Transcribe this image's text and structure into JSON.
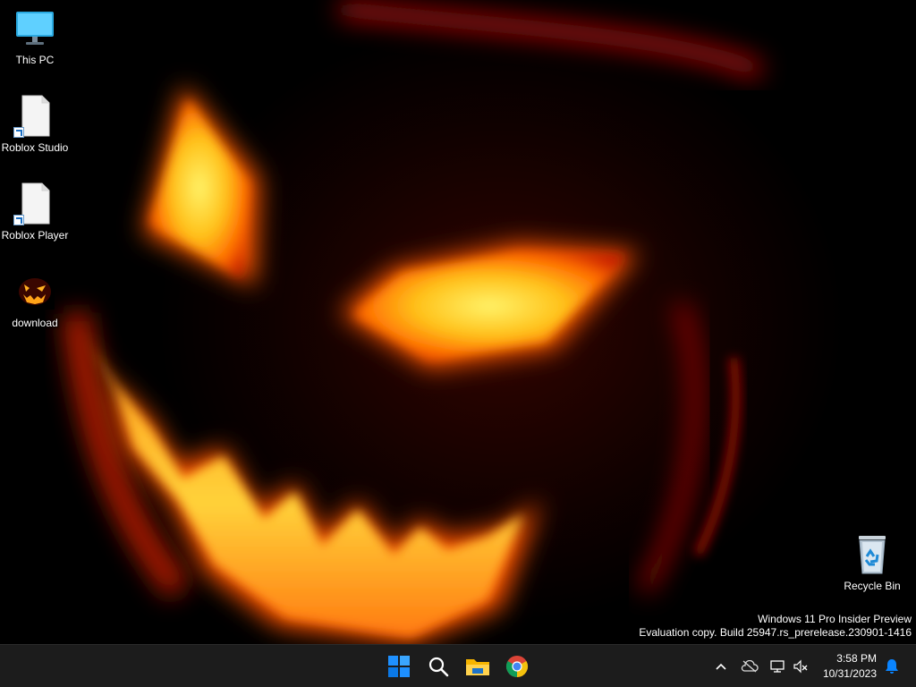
{
  "desktop": {
    "icons": [
      {
        "label": "This PC",
        "icon": "monitor-icon"
      },
      {
        "label": "Roblox Studio",
        "icon": "blank-file-shortcut-icon"
      },
      {
        "label": "Roblox Player",
        "icon": "blank-file-shortcut-icon"
      },
      {
        "label": "download",
        "icon": "jack-o-lantern-image-icon"
      },
      {
        "label": "Recycle Bin",
        "icon": "recycle-bin-icon"
      }
    ],
    "wallpaper": "jack-o-lantern"
  },
  "watermark": {
    "line1": "Windows 11 Pro Insider Preview",
    "line2": "Evaluation copy. Build 25947.rs_prerelease.230901-1416"
  },
  "taskbar": {
    "pinned": [
      {
        "name": "start",
        "icon": "windows-logo-icon"
      },
      {
        "name": "search",
        "icon": "search-icon"
      },
      {
        "name": "file-explorer",
        "icon": "folder-icon"
      },
      {
        "name": "chrome",
        "icon": "chrome-icon"
      }
    ],
    "tray": {
      "icons": [
        "chevron-up-icon",
        "onedrive-offline-icon",
        "network-disconnected-icon",
        "volume-muted-icon",
        "notification-bell-icon"
      ],
      "time": "3:58 PM",
      "date": "10/31/2023"
    },
    "colors": {
      "background": "#1c1c1c",
      "accent": "#0a84ff"
    }
  }
}
